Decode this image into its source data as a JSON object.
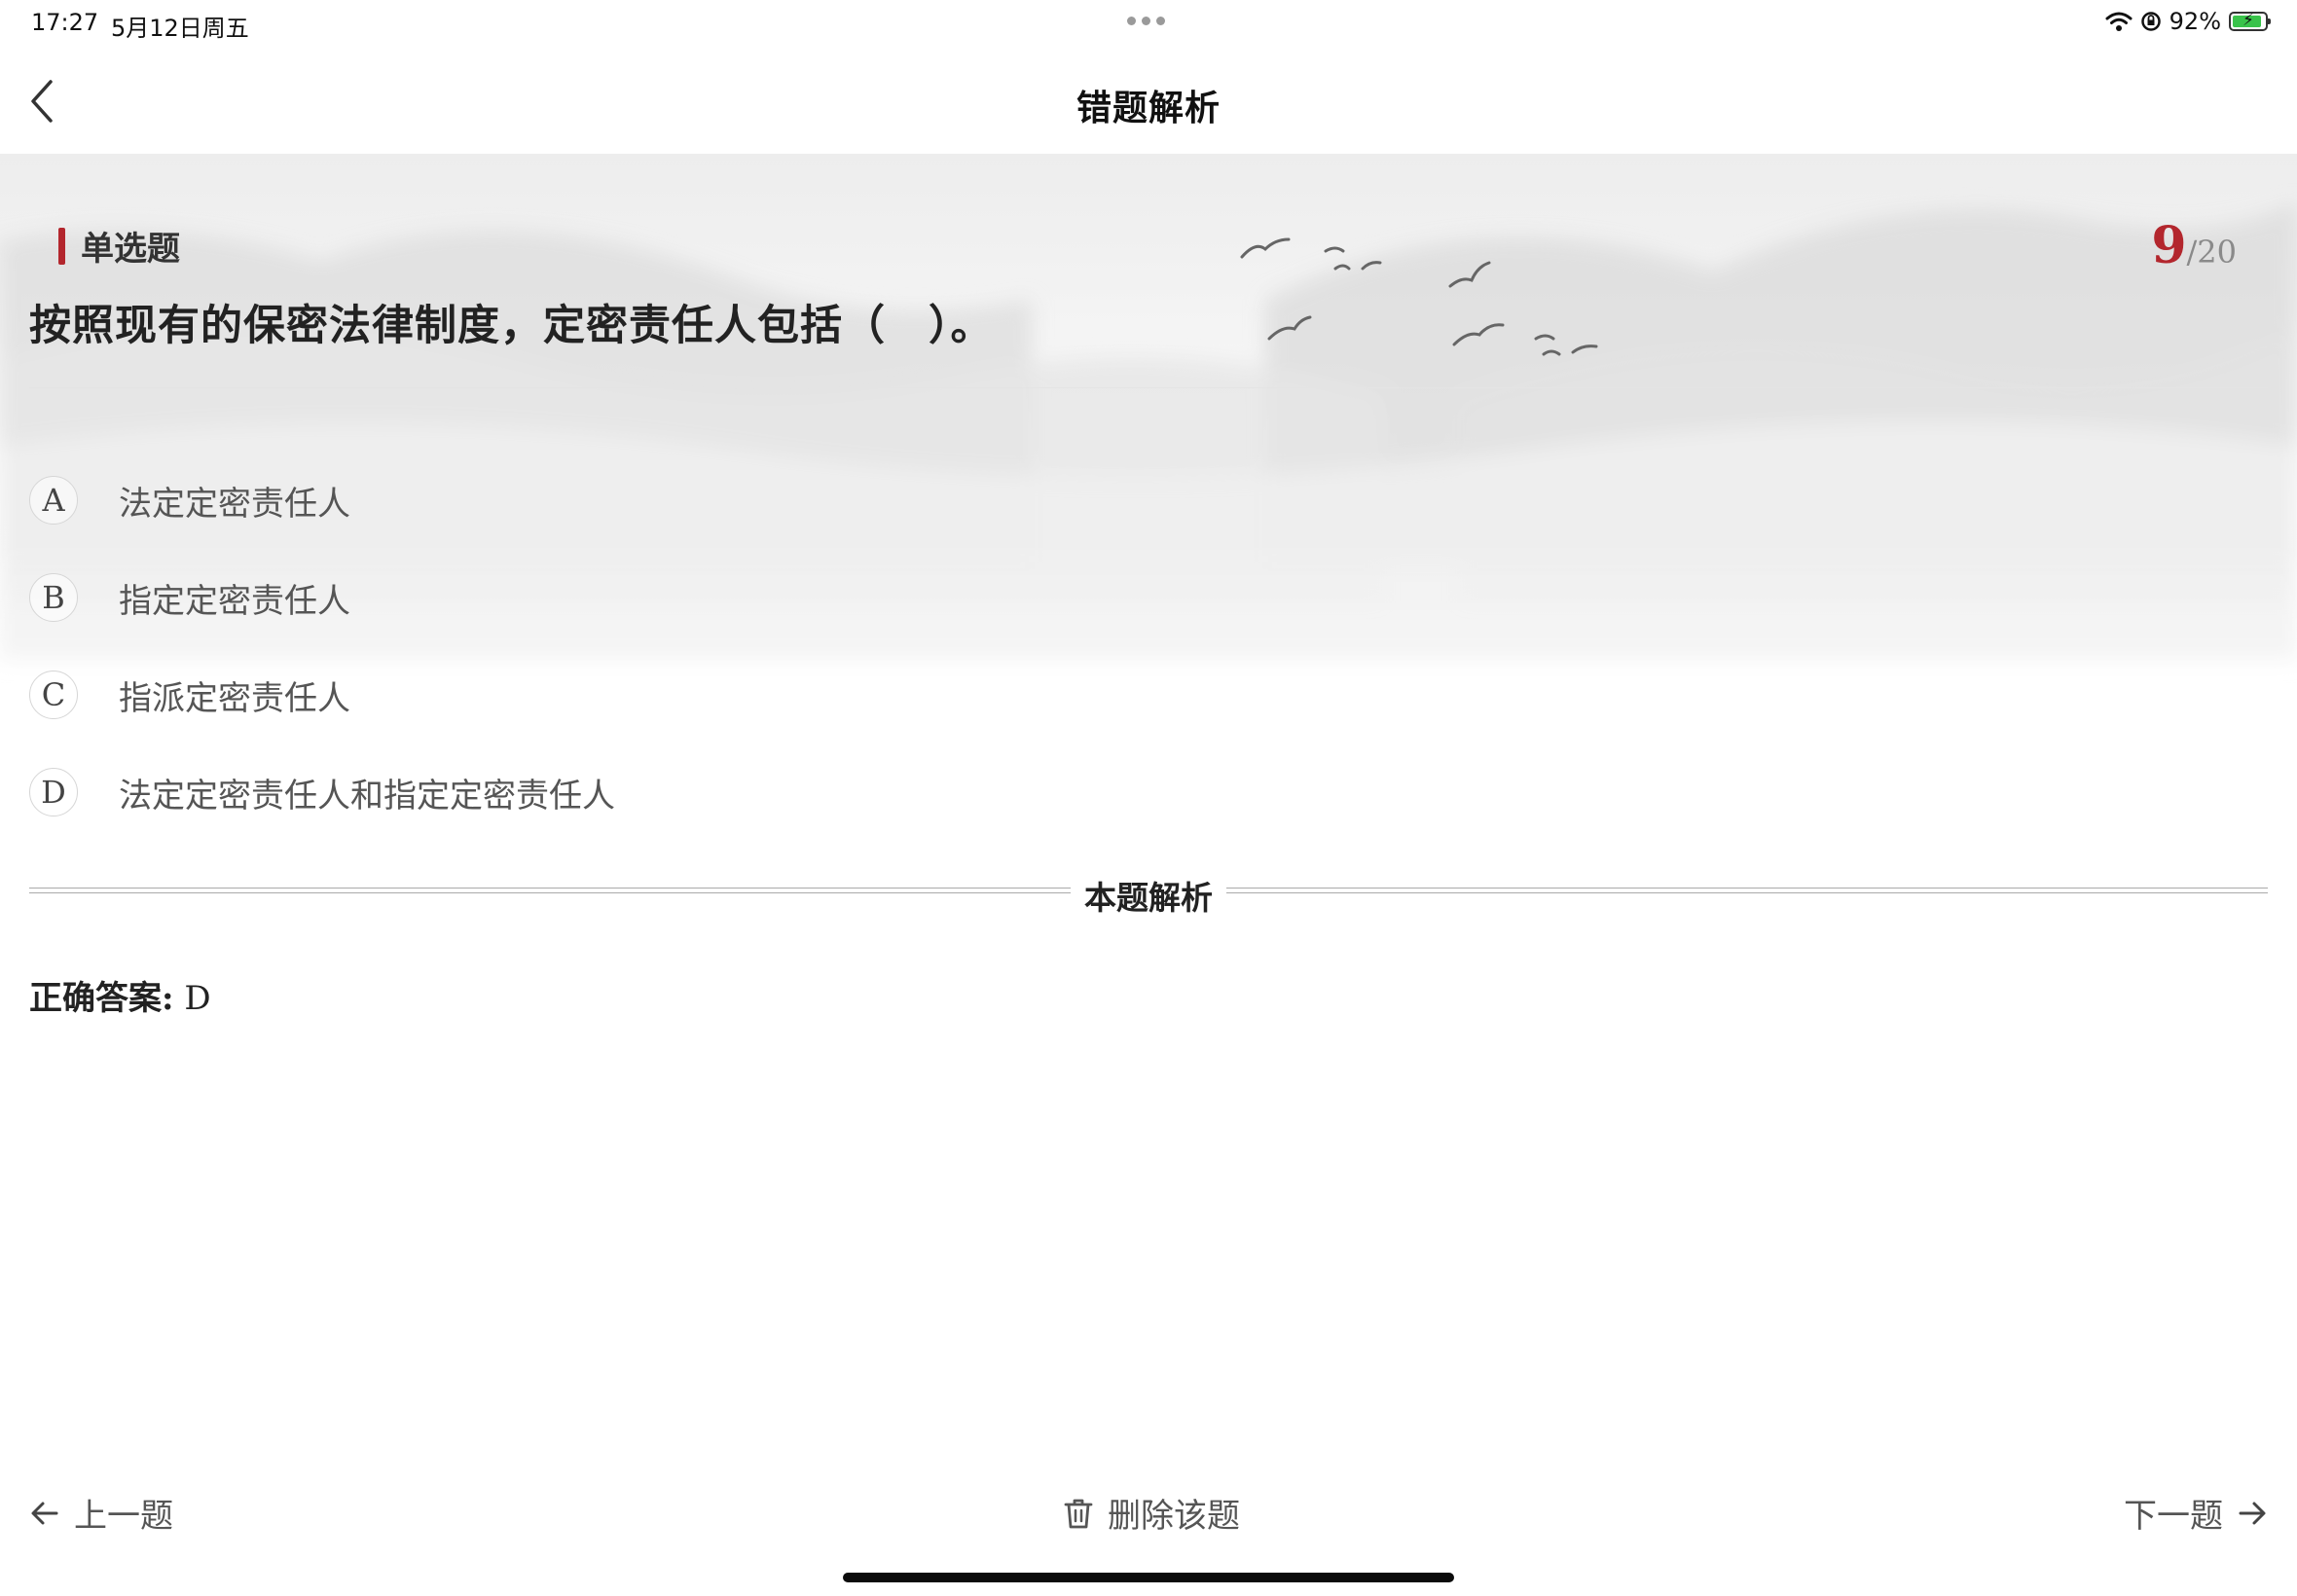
{
  "status_bar": {
    "time": "17:27",
    "date": "5月12日周五",
    "battery_percent": "92%",
    "battery_level": 0.92,
    "icons": [
      "wifi-icon",
      "orientation-lock-icon",
      "battery-charging-icon"
    ]
  },
  "nav": {
    "title": "错题解析",
    "back_icon": "chevron-left-icon"
  },
  "question": {
    "type": "单选题",
    "current": "9",
    "total_text": "/20",
    "text": "按照现有的保密法律制度，定密责任人包括（　）。",
    "options": [
      {
        "letter": "A",
        "text": "法定定密责任人"
      },
      {
        "letter": "B",
        "text": "指定定密责任人"
      },
      {
        "letter": "C",
        "text": "指派定密责任人"
      },
      {
        "letter": "D",
        "text": "法定定密责任人和指定定密责任人"
      }
    ]
  },
  "analysis": {
    "title": "本题解析",
    "answer_label": "正确答案:",
    "answer_value": "D"
  },
  "bottom": {
    "prev_label": "上一题",
    "delete_label": "删除该题",
    "next_label": "下一题"
  },
  "colors": {
    "accent": "#b3262d",
    "text": "#222222",
    "muted": "#555555"
  }
}
